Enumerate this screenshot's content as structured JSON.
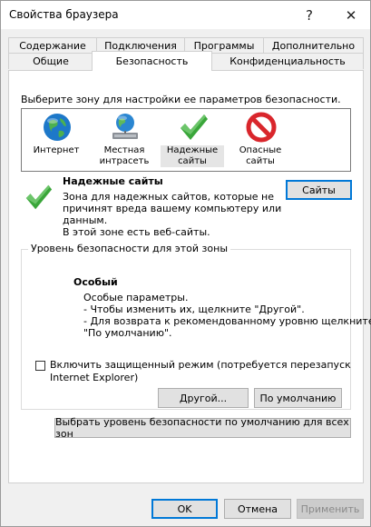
{
  "window": {
    "title": "Свойства браузера",
    "help_label": "?",
    "close_label": "✕"
  },
  "tabs": {
    "back_row": [
      "Содержание",
      "Подключения",
      "Программы",
      "Дополнительно"
    ],
    "front_row": [
      "Общие",
      "Безопасность",
      "Конфиденциальность"
    ],
    "active": "Безопасность"
  },
  "security": {
    "zone_prompt": "Выберите зону для настройки ее параметров безопасности.",
    "zones": [
      {
        "label_line1": "Интернет",
        "label_line2": "",
        "icon": "globe-icon"
      },
      {
        "label_line1": "Местная",
        "label_line2": "интрасеть",
        "icon": "intranet-icon"
      },
      {
        "label_line1": "Надежные",
        "label_line2": "сайты",
        "icon": "checkmark-icon",
        "selected": true
      },
      {
        "label_line1": "Опасные",
        "label_line2": "сайты",
        "icon": "prohibited-icon"
      }
    ],
    "zone_info": {
      "title": "Надежные сайты",
      "desc_lines": [
        "Зона для надежных сайтов, которые не",
        "причинят вреда вашему компьютеру или",
        "данным.",
        "В этой зоне есть веб-сайты."
      ]
    },
    "sites_button": "Сайты",
    "level_group_label": "Уровень безопасности для этой зоны",
    "level": {
      "title": "Особый",
      "lines": [
        "Особые параметры.",
        "- Чтобы изменить их, щелкните \"Другой\".",
        "- Для возврата к рекомендованному уровню щелкните",
        "\"По умолчанию\"."
      ]
    },
    "protected_mode": {
      "checked": false,
      "line1": "Включить защищенный режим (потребуется перезапуск",
      "line2": "Internet Explorer)"
    },
    "custom_button": "Другой...",
    "default_button": "По умолчанию",
    "reset_all_button": "Выбрать уровень безопасности по умолчанию для всех зон"
  },
  "footer": {
    "ok": "OK",
    "cancel": "Отмена",
    "apply": "Применить"
  },
  "colors": {
    "accent": "#0078d7",
    "check_green": "#3aa63a",
    "prohibit_red": "#d9262c"
  }
}
